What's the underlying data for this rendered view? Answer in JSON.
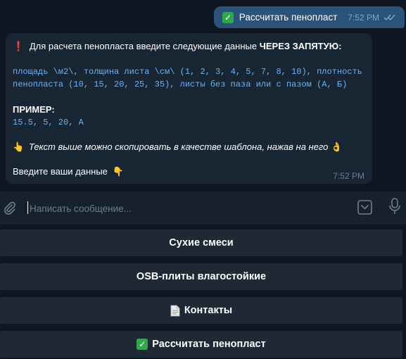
{
  "messages": {
    "outgoing": {
      "icon": "check-mark-emoji",
      "text": "Рассчитать пенопласт",
      "time": "7:52 PM",
      "status": "read"
    },
    "incoming": {
      "line1_icon": "❗",
      "line1_text": "Для расчета пенопласта введите следующие данные ",
      "line1_bold": "ЧЕРЕЗ ЗАПЯТУЮ:",
      "code_line1": "площадь \\м2\\, толщина листа \\см\\ (1, 2, 3, 4, 5, 7, 8, 10), плотность",
      "code_line2": "пенопласта (10, 15, 20, 25, 35), листы без паза или с пазом (А, Б)",
      "example_label": "ПРИМЕР:",
      "example_code": "15.5, 5, 20, А",
      "hint_icon": "👆",
      "hint_text": "Текст выше можно скопировать в качестве шаблона, нажав на него",
      "hint_end_icon": "👌",
      "prompt_text": "Введите ваши данные",
      "prompt_icon": "👇",
      "time": "7:52 PM"
    }
  },
  "composer": {
    "placeholder": "Написать сообщение...",
    "value": ""
  },
  "keyboard": {
    "buttons": [
      {
        "label": "Сухие смеси",
        "icon": ""
      },
      {
        "label": "OSB-плиты влагостойкие",
        "icon": ""
      },
      {
        "label": "Контакты",
        "icon": "document-icon"
      },
      {
        "label": "Рассчитать пенопласт",
        "icon": "check-mark-emoji"
      }
    ]
  },
  "colors": {
    "background": "#0e1621",
    "outgoing_bubble": "#2b5278",
    "incoming_bubble": "#182533",
    "code_text": "#6ab3f3",
    "keyboard_button": "#1f2936",
    "check_green": "#2fa94a"
  }
}
